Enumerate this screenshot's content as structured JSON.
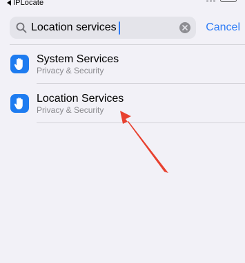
{
  "status_bar": {
    "back_app_label": "IPLocate"
  },
  "search": {
    "value": "Location services",
    "cancel_label": "Cancel"
  },
  "results": [
    {
      "title": "System Services",
      "subtitle": "Privacy & Security",
      "icon": "hand-raised-icon"
    },
    {
      "title": "Location Services",
      "subtitle": "Privacy & Security",
      "icon": "hand-raised-icon"
    }
  ],
  "colors": {
    "accent": "#2f7cf6",
    "icon_bg": "#1e7cf0",
    "background": "#f2f1f7",
    "annotation": "#e8412f"
  }
}
